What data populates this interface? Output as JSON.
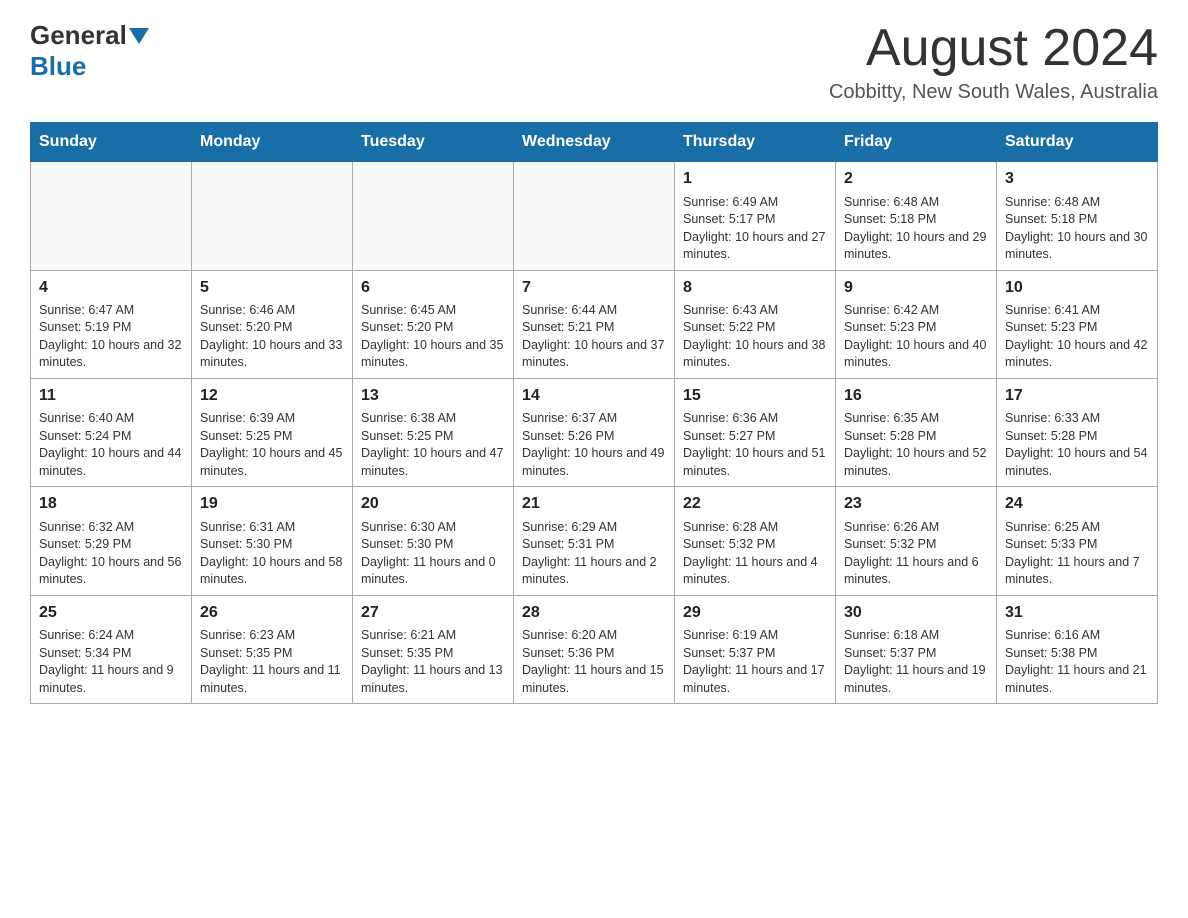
{
  "header": {
    "logo_general": "General",
    "logo_blue": "Blue",
    "month_title": "August 2024",
    "location": "Cobbitty, New South Wales, Australia"
  },
  "weekdays": [
    "Sunday",
    "Monday",
    "Tuesday",
    "Wednesday",
    "Thursday",
    "Friday",
    "Saturday"
  ],
  "weeks": [
    [
      {
        "day": "",
        "info": ""
      },
      {
        "day": "",
        "info": ""
      },
      {
        "day": "",
        "info": ""
      },
      {
        "day": "",
        "info": ""
      },
      {
        "day": "1",
        "info": "Sunrise: 6:49 AM\nSunset: 5:17 PM\nDaylight: 10 hours and 27 minutes."
      },
      {
        "day": "2",
        "info": "Sunrise: 6:48 AM\nSunset: 5:18 PM\nDaylight: 10 hours and 29 minutes."
      },
      {
        "day": "3",
        "info": "Sunrise: 6:48 AM\nSunset: 5:18 PM\nDaylight: 10 hours and 30 minutes."
      }
    ],
    [
      {
        "day": "4",
        "info": "Sunrise: 6:47 AM\nSunset: 5:19 PM\nDaylight: 10 hours and 32 minutes."
      },
      {
        "day": "5",
        "info": "Sunrise: 6:46 AM\nSunset: 5:20 PM\nDaylight: 10 hours and 33 minutes."
      },
      {
        "day": "6",
        "info": "Sunrise: 6:45 AM\nSunset: 5:20 PM\nDaylight: 10 hours and 35 minutes."
      },
      {
        "day": "7",
        "info": "Sunrise: 6:44 AM\nSunset: 5:21 PM\nDaylight: 10 hours and 37 minutes."
      },
      {
        "day": "8",
        "info": "Sunrise: 6:43 AM\nSunset: 5:22 PM\nDaylight: 10 hours and 38 minutes."
      },
      {
        "day": "9",
        "info": "Sunrise: 6:42 AM\nSunset: 5:23 PM\nDaylight: 10 hours and 40 minutes."
      },
      {
        "day": "10",
        "info": "Sunrise: 6:41 AM\nSunset: 5:23 PM\nDaylight: 10 hours and 42 minutes."
      }
    ],
    [
      {
        "day": "11",
        "info": "Sunrise: 6:40 AM\nSunset: 5:24 PM\nDaylight: 10 hours and 44 minutes."
      },
      {
        "day": "12",
        "info": "Sunrise: 6:39 AM\nSunset: 5:25 PM\nDaylight: 10 hours and 45 minutes."
      },
      {
        "day": "13",
        "info": "Sunrise: 6:38 AM\nSunset: 5:25 PM\nDaylight: 10 hours and 47 minutes."
      },
      {
        "day": "14",
        "info": "Sunrise: 6:37 AM\nSunset: 5:26 PM\nDaylight: 10 hours and 49 minutes."
      },
      {
        "day": "15",
        "info": "Sunrise: 6:36 AM\nSunset: 5:27 PM\nDaylight: 10 hours and 51 minutes."
      },
      {
        "day": "16",
        "info": "Sunrise: 6:35 AM\nSunset: 5:28 PM\nDaylight: 10 hours and 52 minutes."
      },
      {
        "day": "17",
        "info": "Sunrise: 6:33 AM\nSunset: 5:28 PM\nDaylight: 10 hours and 54 minutes."
      }
    ],
    [
      {
        "day": "18",
        "info": "Sunrise: 6:32 AM\nSunset: 5:29 PM\nDaylight: 10 hours and 56 minutes."
      },
      {
        "day": "19",
        "info": "Sunrise: 6:31 AM\nSunset: 5:30 PM\nDaylight: 10 hours and 58 minutes."
      },
      {
        "day": "20",
        "info": "Sunrise: 6:30 AM\nSunset: 5:30 PM\nDaylight: 11 hours and 0 minutes."
      },
      {
        "day": "21",
        "info": "Sunrise: 6:29 AM\nSunset: 5:31 PM\nDaylight: 11 hours and 2 minutes."
      },
      {
        "day": "22",
        "info": "Sunrise: 6:28 AM\nSunset: 5:32 PM\nDaylight: 11 hours and 4 minutes."
      },
      {
        "day": "23",
        "info": "Sunrise: 6:26 AM\nSunset: 5:32 PM\nDaylight: 11 hours and 6 minutes."
      },
      {
        "day": "24",
        "info": "Sunrise: 6:25 AM\nSunset: 5:33 PM\nDaylight: 11 hours and 7 minutes."
      }
    ],
    [
      {
        "day": "25",
        "info": "Sunrise: 6:24 AM\nSunset: 5:34 PM\nDaylight: 11 hours and 9 minutes."
      },
      {
        "day": "26",
        "info": "Sunrise: 6:23 AM\nSunset: 5:35 PM\nDaylight: 11 hours and 11 minutes."
      },
      {
        "day": "27",
        "info": "Sunrise: 6:21 AM\nSunset: 5:35 PM\nDaylight: 11 hours and 13 minutes."
      },
      {
        "day": "28",
        "info": "Sunrise: 6:20 AM\nSunset: 5:36 PM\nDaylight: 11 hours and 15 minutes."
      },
      {
        "day": "29",
        "info": "Sunrise: 6:19 AM\nSunset: 5:37 PM\nDaylight: 11 hours and 17 minutes."
      },
      {
        "day": "30",
        "info": "Sunrise: 6:18 AM\nSunset: 5:37 PM\nDaylight: 11 hours and 19 minutes."
      },
      {
        "day": "31",
        "info": "Sunrise: 6:16 AM\nSunset: 5:38 PM\nDaylight: 11 hours and 21 minutes."
      }
    ]
  ]
}
